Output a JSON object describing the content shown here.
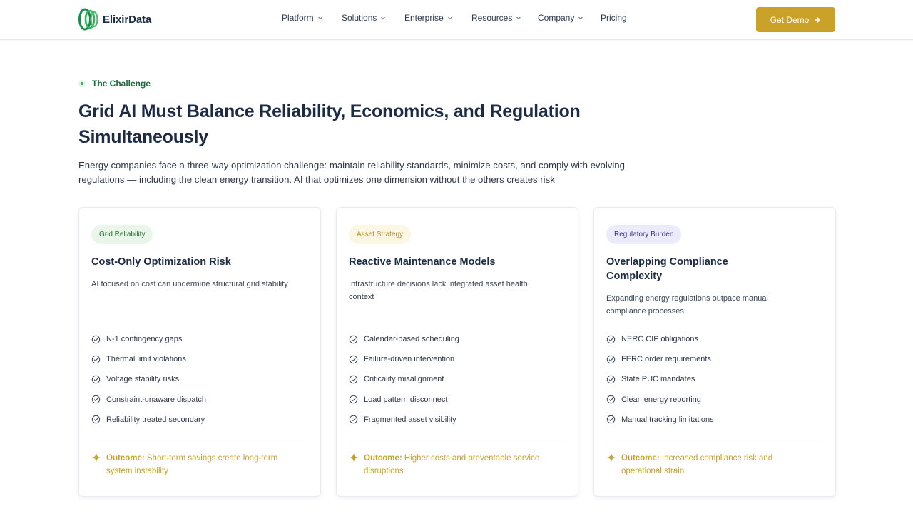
{
  "brand": {
    "name": "ElixirData",
    "accent": "#c9a227",
    "primary_green": "#1a8a4a"
  },
  "nav": {
    "items": [
      {
        "label": "Platform",
        "dropdown": true
      },
      {
        "label": "Solutions",
        "dropdown": true
      },
      {
        "label": "Enterprise",
        "dropdown": true
      },
      {
        "label": "Resources",
        "dropdown": true
      },
      {
        "label": "Company",
        "dropdown": true
      },
      {
        "label": "Pricing",
        "dropdown": false
      }
    ],
    "cta_label": "Get Demo"
  },
  "hero": {
    "eyebrow": "The Challenge",
    "title_line1": "Grid AI Must Balance Reliability, Economics, and Regulation",
    "title_line2": "Simultaneously",
    "description": "Energy companies face a three-way optimization challenge: maintain reliability standards, minimize costs, and comply with evolving regulations — including the clean energy transition. AI that optimizes one dimension without the others creates risk"
  },
  "cards": [
    {
      "badge": "Grid Reliability",
      "badge_bg": "#eaf6ea",
      "badge_color": "#1f6b2c",
      "title": "Cost-Only Optimization Risk",
      "description": "AI focused on cost can undermine structural grid stability",
      "items": [
        "N-1 contingency gaps",
        "Thermal limit violations",
        "Voltage stability risks",
        "Constraint-unaware dispatch",
        "Reliability treated secondary"
      ],
      "outcome_label": "Outcome:",
      "outcome_text": "Short-term savings create long-term system instability"
    },
    {
      "badge": "Asset Strategy",
      "badge_bg": "#fcf6e4",
      "badge_color": "#b8901c",
      "title": "Reactive Maintenance Models",
      "description": "Infrastructure decisions lack integrated asset health context",
      "items": [
        "Calendar-based scheduling",
        "Failure-driven intervention",
        "Criticality misalignment",
        "Load pattern disconnect",
        "Fragmented asset visibility"
      ],
      "outcome_label": "Outcome:",
      "outcome_text": "Higher costs and preventable service disruptions"
    },
    {
      "badge": "Regulatory Burden",
      "badge_bg": "#ecebfb",
      "badge_color": "#3b2f8f",
      "title": "Overlapping Compliance Complexity",
      "description": "Expanding energy regulations outpace manual compliance processes",
      "items": [
        "NERC CIP obligations",
        "FERC order requirements",
        "State PUC mandates",
        "Clean energy reporting",
        "Manual tracking limitations"
      ],
      "outcome_label": "Outcome:",
      "outcome_text": "Increased compliance risk and operational strain"
    }
  ]
}
